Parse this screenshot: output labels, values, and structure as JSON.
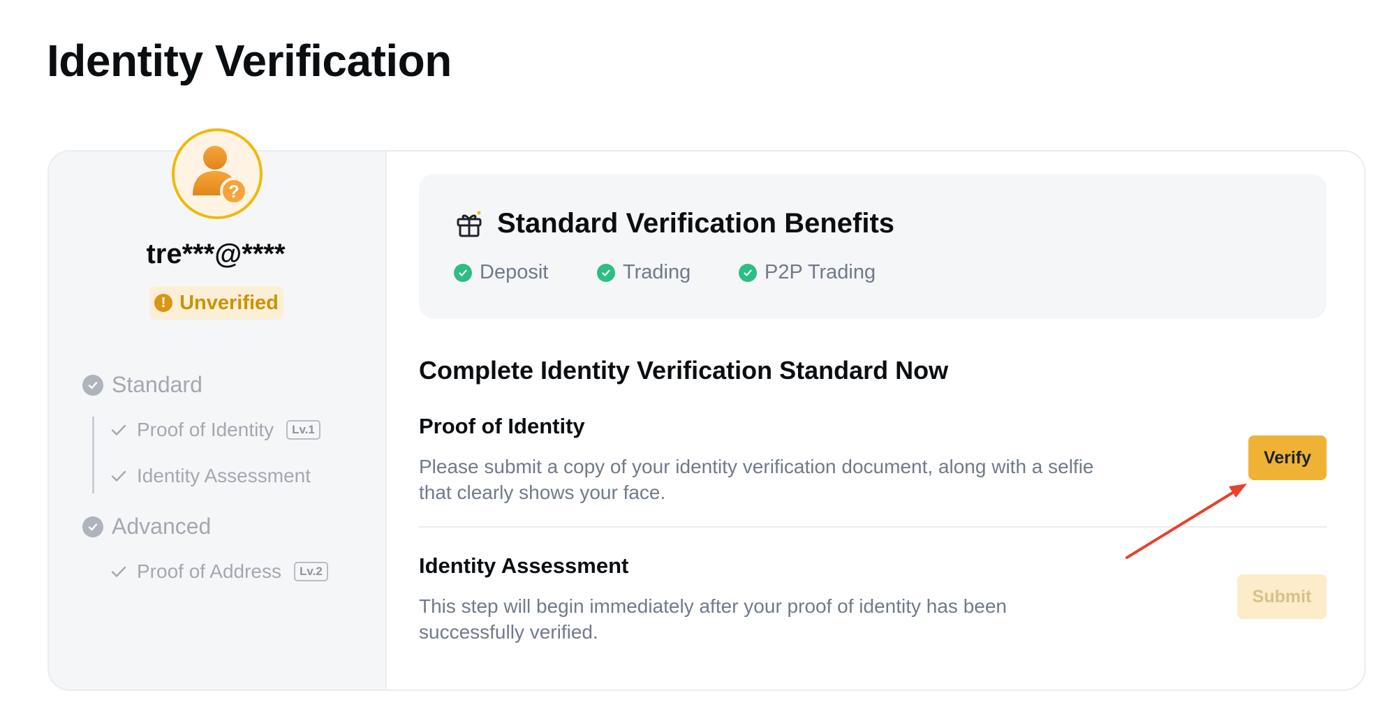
{
  "page_title": "Identity Verification",
  "profile": {
    "username": "tre***@****",
    "status": "Unverified",
    "avatar_icon": "user-question-icon",
    "status_icon": "warning-icon"
  },
  "levels": [
    {
      "label": "Standard",
      "steps": [
        {
          "label": "Proof of Identity",
          "tag": "Lv.1"
        },
        {
          "label": "Identity Assessment",
          "tag": ""
        }
      ]
    },
    {
      "label": "Advanced",
      "steps": [
        {
          "label": "Proof of Address",
          "tag": "Lv.2"
        }
      ]
    }
  ],
  "benefits": {
    "title": "Standard Verification Benefits",
    "icon": "gift-icon",
    "items": [
      "Deposit",
      "Trading",
      "P2P Trading"
    ]
  },
  "main": {
    "section_title": "Complete Identity Verification Standard Now",
    "proof_of_identity": {
      "title": "Proof of Identity",
      "description": "Please submit a copy of your identity verification document, along with a selfie that clearly shows your face.",
      "button": "Verify"
    },
    "identity_assessment": {
      "title": "Identity Assessment",
      "description": "This step will begin immediately after your proof of identity has been successfully verified.",
      "button": "Submit"
    }
  },
  "colors": {
    "accent": "#efb234",
    "accent_disabled": "#fcecc9",
    "success": "#2ebd85",
    "warning": "#d89614",
    "annotation_arrow": "#e8412c"
  }
}
